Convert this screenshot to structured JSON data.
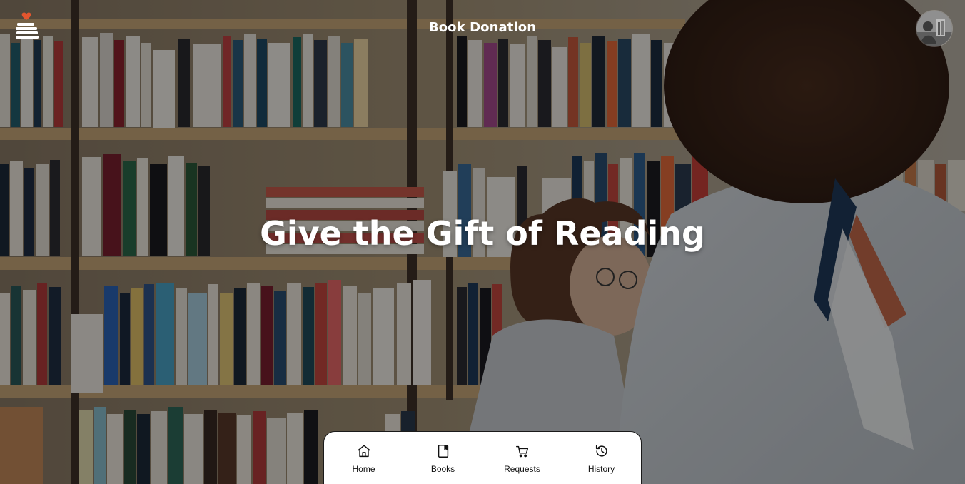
{
  "header": {
    "title": "Book Donation",
    "logo_icon": "book-stack-heart-icon",
    "avatar_icon": "user-avatar"
  },
  "hero": {
    "title": "Give the Gift of Reading"
  },
  "bottom_nav": {
    "items": [
      {
        "label": "Home",
        "icon": "home-icon"
      },
      {
        "label": "Books",
        "icon": "book-icon"
      },
      {
        "label": "Requests",
        "icon": "cart-icon"
      },
      {
        "label": "History",
        "icon": "history-icon"
      }
    ]
  },
  "colors": {
    "logo_heart": "#e2552e",
    "nav_background": "#ffffff",
    "text_light": "#ffffff"
  }
}
